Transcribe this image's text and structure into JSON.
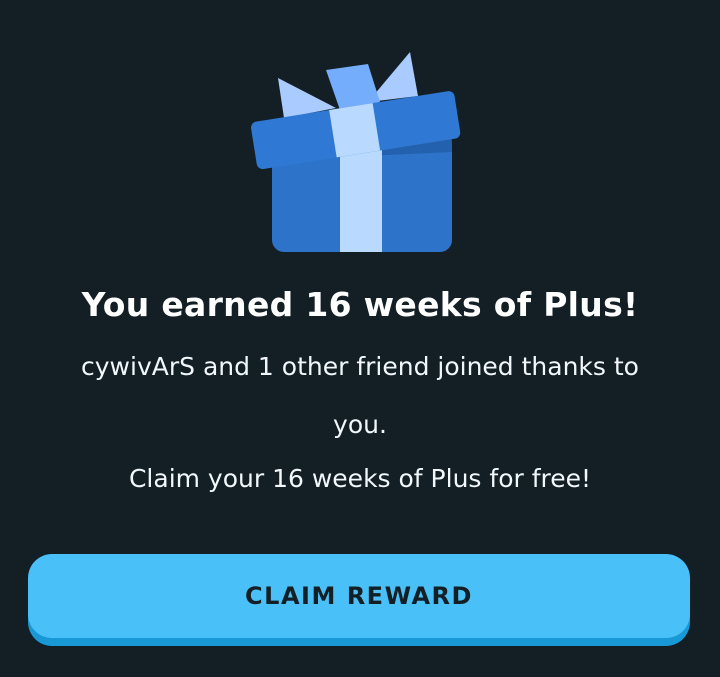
{
  "dialog": {
    "icon": "gift-box-icon",
    "title": "You earned 16 weeks of Plus!",
    "message_line1": "cywivArS and 1 other friend joined thanks to",
    "message_line2": "you.",
    "message_line3": "Claim your 16 weeks of Plus for free!",
    "button_label": "CLAIM REWARD"
  },
  "colors": {
    "background": "#131f24",
    "button": "#49c0f8",
    "button_shadow": "#1899d6",
    "gift_box": "#2e73c8",
    "gift_ribbon": "#b9d9ff"
  }
}
